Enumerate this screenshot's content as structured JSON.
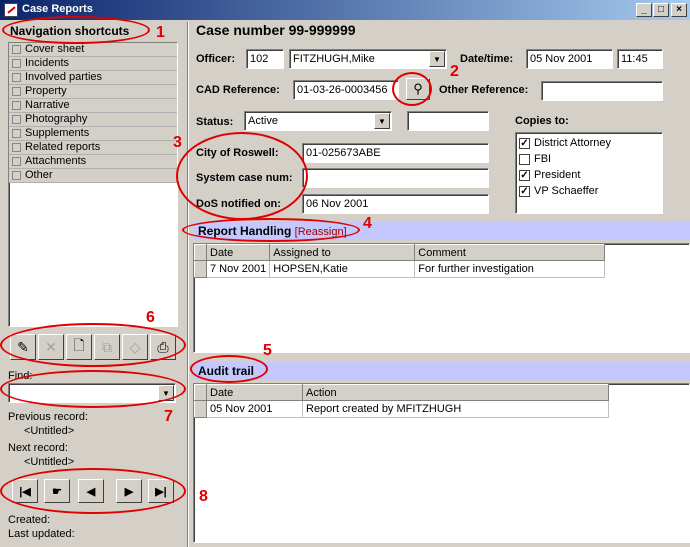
{
  "window": {
    "title": "Case Reports"
  },
  "nav": {
    "header": "Navigation shortcuts",
    "items": [
      "Cover sheet",
      "Incidents",
      "Involved parties",
      "Property",
      "Narrative",
      "Photography",
      "Supplements",
      "Related reports",
      "Attachments",
      "Other"
    ]
  },
  "find": {
    "label": "Find:",
    "value": ""
  },
  "records": {
    "previous_label": "Previous record:",
    "previous_value": "<Untitled>",
    "next_label": "Next record:",
    "next_value": "<Untitled>"
  },
  "footer": {
    "created_label": "Created:",
    "updated_label": "Last updated:"
  },
  "case": {
    "title": "Case number 99-999999",
    "officer_label": "Officer:",
    "officer_id": "102",
    "officer_name": "FITZHUGH,Mike",
    "datetime_label": "Date/time:",
    "date": "05 Nov 2001",
    "time": "11:45",
    "cad_label": "CAD Reference:",
    "cad_value": "01-03-26-0003456",
    "other_ref_label": "Other Reference:",
    "other_ref_value": "",
    "status_label": "Status:",
    "status_value": "Active",
    "status_extra": "",
    "city_label": "City of Roswell:",
    "city_value": "01-025673ABE",
    "system_label": "System case num:",
    "system_value": "",
    "dos_label": "DoS notified on:",
    "dos_value": "06 Nov 2001"
  },
  "copies": {
    "label": "Copies to:",
    "items": [
      {
        "name": "District Attorney",
        "checked": true
      },
      {
        "name": "FBI",
        "checked": false
      },
      {
        "name": "President",
        "checked": true
      },
      {
        "name": "VP Schaeffer",
        "checked": true
      }
    ]
  },
  "report_handling": {
    "title": "Report Handling",
    "reassign": "[Reassign]",
    "columns": [
      "Date",
      "Assigned to",
      "Comment"
    ],
    "rows": [
      [
        "7 Nov 2001",
        "HOPSEN,Katie",
        "For further investigation"
      ]
    ]
  },
  "audit": {
    "title": "Audit trail",
    "columns": [
      "Date",
      "Action"
    ],
    "rows": [
      [
        "05 Nov 2001",
        "Report created by MFITZHUGH"
      ]
    ]
  },
  "annotations": [
    "1",
    "2",
    "3",
    "4",
    "5",
    "6",
    "7",
    "8"
  ],
  "colors": {
    "annotation": "#e00000",
    "section_bar": "#c4c8ff",
    "title_bar": "#0a246a"
  }
}
